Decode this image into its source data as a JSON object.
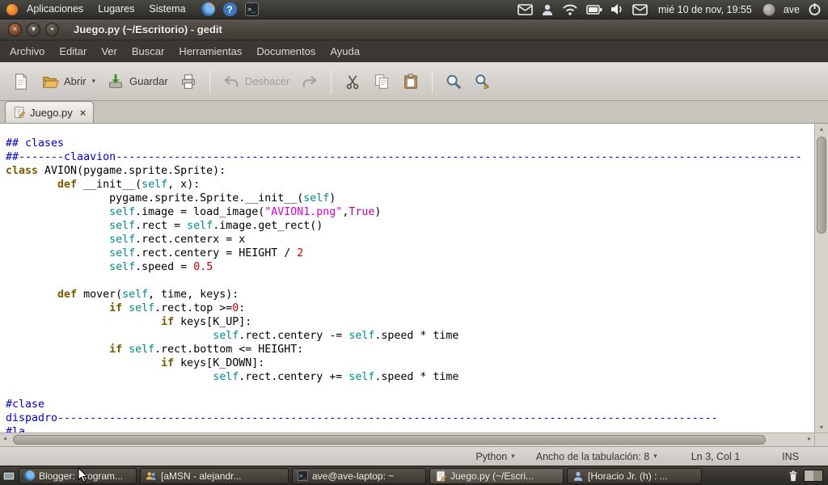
{
  "top_panel": {
    "menus": [
      "Aplicaciones",
      "Lugares",
      "Sistema"
    ],
    "clock": "mié 10 de nov, 19:55",
    "username": "ave"
  },
  "titlebar": {
    "title": "Juego.py (~/Escritorio) - gedit"
  },
  "menubar": {
    "items": [
      "Archivo",
      "Editar",
      "Ver",
      "Buscar",
      "Herramientas",
      "Documentos",
      "Ayuda"
    ]
  },
  "toolbar": {
    "open": "Abrir",
    "save": "Guardar",
    "undo": "Deshacer"
  },
  "tabbar": {
    "tab_label": "Juego.py",
    "close_glyph": "×"
  },
  "statusbar": {
    "language": "Python",
    "tab_width": "Ancho de la tabulación: 8",
    "cursor_pos": "Ln 3, Col 1",
    "mode": "INS"
  },
  "taskbar": {
    "items": [
      {
        "label": "Blogger: Program..."
      },
      {
        "label": "[aMSN - alejandr..."
      },
      {
        "label": "ave@ave-laptop: ~"
      },
      {
        "label": "Juego.py (~/Escri..."
      },
      {
        "label": "[Horacio Jr. (h) : ..."
      }
    ]
  },
  "window_buttons": {
    "close": "×",
    "minimize": "▾",
    "maximize": "▪"
  },
  "editor": {
    "colors": {
      "com": "#0000e0",
      "kw": "#7a5c00",
      "self": "#008b8b",
      "str": "#da00da",
      "num": "#cc0000",
      "bool": "#b400b4",
      "pl": "#000000"
    },
    "lines": [
      [
        [
          "com",
          "## clases"
        ]
      ],
      [
        [
          "com",
          "##-------claavion----------------------------------------------------------------------------------------------------------"
        ]
      ],
      [
        [
          "kw",
          "class"
        ],
        [
          "pl",
          " AVION(pygame.sprite.Sprite):"
        ]
      ],
      [
        [
          "pl",
          "\t"
        ],
        [
          "kw",
          "def"
        ],
        [
          "pl",
          " __init__("
        ],
        [
          "self",
          "self"
        ],
        [
          "pl",
          ", x):"
        ]
      ],
      [
        [
          "pl",
          "\t\tpygame.sprite.Sprite.__init__("
        ],
        [
          "self",
          "self"
        ],
        [
          "pl",
          ")"
        ]
      ],
      [
        [
          "pl",
          "\t\t"
        ],
        [
          "self",
          "self"
        ],
        [
          "pl",
          ".image = load_image("
        ],
        [
          "str",
          "\"AVION1.png\""
        ],
        [
          "pl",
          ","
        ],
        [
          "bool",
          "True"
        ],
        [
          "pl",
          ")"
        ]
      ],
      [
        [
          "pl",
          "\t\t"
        ],
        [
          "self",
          "self"
        ],
        [
          "pl",
          ".rect = "
        ],
        [
          "self",
          "self"
        ],
        [
          "pl",
          ".image.get_rect()"
        ]
      ],
      [
        [
          "pl",
          "\t\t"
        ],
        [
          "self",
          "self"
        ],
        [
          "pl",
          ".rect.centerx = x"
        ]
      ],
      [
        [
          "pl",
          "\t\t"
        ],
        [
          "self",
          "self"
        ],
        [
          "pl",
          ".rect.centery = HEIGHT / "
        ],
        [
          "num",
          "2"
        ]
      ],
      [
        [
          "pl",
          "\t\t"
        ],
        [
          "self",
          "self"
        ],
        [
          "pl",
          ".speed = "
        ],
        [
          "num",
          "0.5"
        ]
      ],
      [],
      [
        [
          "pl",
          "\t"
        ],
        [
          "kw",
          "def"
        ],
        [
          "pl",
          " mover("
        ],
        [
          "self",
          "self"
        ],
        [
          "pl",
          ", time, keys):"
        ]
      ],
      [
        [
          "pl",
          "\t\t"
        ],
        [
          "kw",
          "if"
        ],
        [
          "pl",
          " "
        ],
        [
          "self",
          "self"
        ],
        [
          "pl",
          ".rect.top >="
        ],
        [
          "num",
          "0"
        ],
        [
          "pl",
          ":"
        ]
      ],
      [
        [
          "pl",
          "\t\t\t"
        ],
        [
          "kw",
          "if"
        ],
        [
          "pl",
          " keys[K_UP]:"
        ]
      ],
      [
        [
          "pl",
          "\t\t\t\t"
        ],
        [
          "self",
          "self"
        ],
        [
          "pl",
          ".rect.centery -= "
        ],
        [
          "self",
          "self"
        ],
        [
          "pl",
          ".speed * time"
        ]
      ],
      [
        [
          "pl",
          "\t\t"
        ],
        [
          "kw",
          "if"
        ],
        [
          "pl",
          " "
        ],
        [
          "self",
          "self"
        ],
        [
          "pl",
          ".rect.bottom <= HEIGHT:"
        ]
      ],
      [
        [
          "pl",
          "\t\t\t"
        ],
        [
          "kw",
          "if"
        ],
        [
          "pl",
          " keys[K_DOWN]:"
        ]
      ],
      [
        [
          "pl",
          "\t\t\t\t"
        ],
        [
          "self",
          "self"
        ],
        [
          "pl",
          ".rect.centery += "
        ],
        [
          "self",
          "self"
        ],
        [
          "pl",
          ".speed * time"
        ]
      ],
      [],
      [
        [
          "com",
          "#clase"
        ]
      ],
      [
        [
          "com",
          "dispadro------------------------------------------------------------------------------------------------------"
        ]
      ],
      [
        [
          "com",
          "#la"
        ]
      ]
    ]
  }
}
